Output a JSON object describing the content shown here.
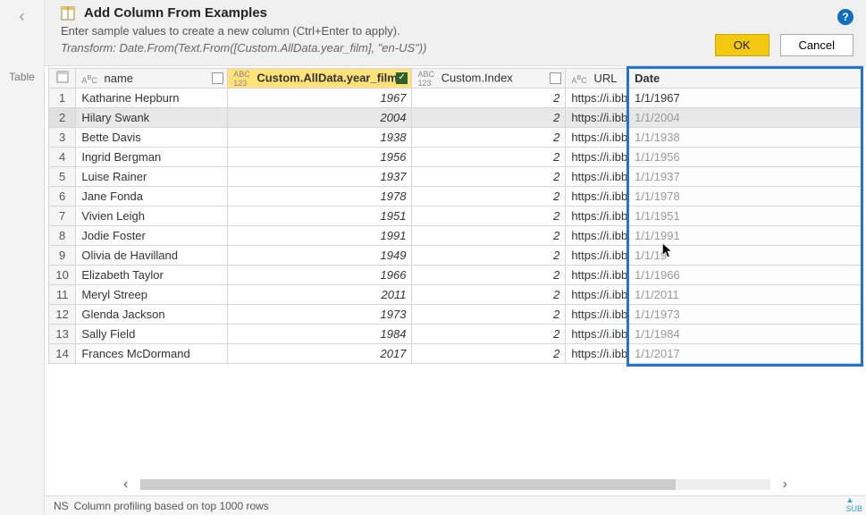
{
  "left": {
    "table_label": "Table"
  },
  "header": {
    "title": "Add Column From Examples",
    "subtitle": "Enter sample values to create a new column (Ctrl+Enter to apply).",
    "formula": "Transform: Date.From(Text.From([Custom.AllData.year_film], \"en-US\"))",
    "ok": "OK",
    "cancel": "Cancel"
  },
  "columns": {
    "name": {
      "type": "ABC",
      "label": "name"
    },
    "year": {
      "type": "ABC123",
      "label": "Custom.AllData.year_film"
    },
    "index": {
      "type": "ABC123",
      "label": "Custom.Index"
    },
    "url": {
      "type": "ABC",
      "label": "URL"
    },
    "date": {
      "label": "Date"
    }
  },
  "rows": [
    {
      "n": "1",
      "name": "Katharine Hepburn",
      "year": "1967",
      "index": "2",
      "url": "https://i.ibb",
      "date": "1/1/1967"
    },
    {
      "n": "2",
      "name": "Hilary Swank",
      "year": "2004",
      "index": "2",
      "url": "https://i.ibb",
      "date": "1/1/2004"
    },
    {
      "n": "3",
      "name": "Bette Davis",
      "year": "1938",
      "index": "2",
      "url": "https://i.ibb",
      "date": "1/1/1938"
    },
    {
      "n": "4",
      "name": "Ingrid Bergman",
      "year": "1956",
      "index": "2",
      "url": "https://i.ibb",
      "date": "1/1/1956"
    },
    {
      "n": "5",
      "name": "Luise Rainer",
      "year": "1937",
      "index": "2",
      "url": "https://i.ibb",
      "date": "1/1/1937"
    },
    {
      "n": "6",
      "name": "Jane Fonda",
      "year": "1978",
      "index": "2",
      "url": "https://i.ibb",
      "date": "1/1/1978"
    },
    {
      "n": "7",
      "name": "Vivien Leigh",
      "year": "1951",
      "index": "2",
      "url": "https://i.ibb",
      "date": "1/1/1951"
    },
    {
      "n": "8",
      "name": "Jodie Foster",
      "year": "1991",
      "index": "2",
      "url": "https://i.ibb",
      "date": "1/1/1991"
    },
    {
      "n": "9",
      "name": "Olivia de Havilland",
      "year": "1949",
      "index": "2",
      "url": "https://i.ibb",
      "date": "1/1/19"
    },
    {
      "n": "10",
      "name": "Elizabeth Taylor",
      "year": "1966",
      "index": "2",
      "url": "https://i.ibb",
      "date": "1/1/1966"
    },
    {
      "n": "11",
      "name": "Meryl Streep",
      "year": "2011",
      "index": "2",
      "url": "https://i.ibb",
      "date": "1/1/2011"
    },
    {
      "n": "12",
      "name": "Glenda Jackson",
      "year": "1973",
      "index": "2",
      "url": "https://i.ibb",
      "date": "1/1/1973"
    },
    {
      "n": "13",
      "name": "Sally Field",
      "year": "1984",
      "index": "2",
      "url": "https://i.ibb",
      "date": "1/1/1984"
    },
    {
      "n": "14",
      "name": "Frances McDormand",
      "year": "2017",
      "index": "2",
      "url": "https://i.ibb",
      "date": "1/1/2017"
    }
  ],
  "status": {
    "text": "Column profiling based on top 1000 rows",
    "prefix": "NS"
  },
  "accent": "#f2c811",
  "highlight": "#2373cf",
  "selected_row_index": 1
}
